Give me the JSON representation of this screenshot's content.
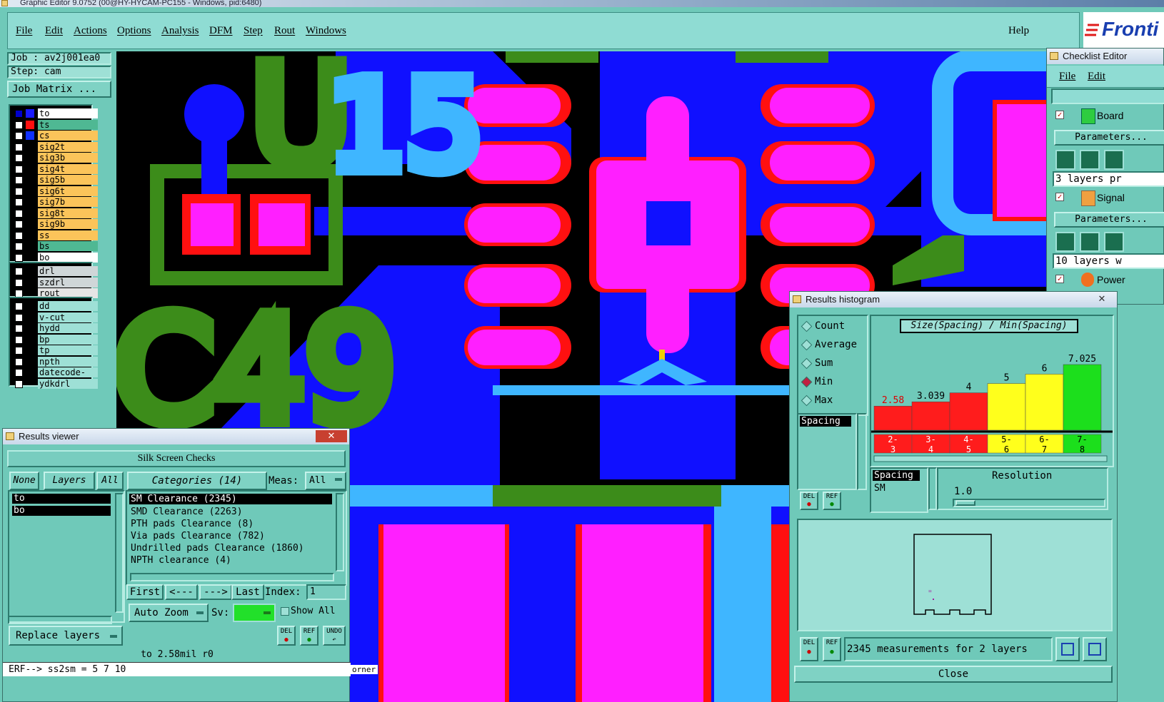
{
  "window_title": "Graphic Editor 9.0752 (00@HY-HYCAM-PC155 - Windows, pid:6480)",
  "menu": [
    "File",
    "Edit",
    "Actions",
    "Options",
    "Analysis",
    "DFM",
    "Step",
    "Rout",
    "Windows"
  ],
  "help_label": "Help",
  "logo_text": "Fronti",
  "job": {
    "job_label": "Job : av2j001ea0",
    "step_label": "Step: cam",
    "matrix_button": "Job Matrix ..."
  },
  "layers_group1": [
    {
      "name": "to",
      "color": "#1a1aff",
      "selected": true
    },
    {
      "name": "ts",
      "color": "#ff1010"
    },
    {
      "name": "cs",
      "color": "#1030ff"
    },
    {
      "name": "sig2t"
    },
    {
      "name": "sig3b"
    },
    {
      "name": "sig4t"
    },
    {
      "name": "sig5b"
    },
    {
      "name": "sig6t"
    },
    {
      "name": "sig7b"
    },
    {
      "name": "sig8t"
    },
    {
      "name": "sig9b"
    },
    {
      "name": "ss"
    },
    {
      "name": "bs"
    },
    {
      "name": "bo"
    }
  ],
  "layers_group2": [
    "drl",
    "szdrl",
    "rout"
  ],
  "layers_group3": [
    "dd",
    "v-cut",
    "hydd",
    "bp",
    "tp",
    "npth",
    "datecode-pte",
    "ydkdrl"
  ],
  "silkscreen": {
    "big_text1": "U",
    "big_text2": "15",
    "big_text3": "C49"
  },
  "results_viewer": {
    "title": "Results viewer",
    "header": "Silk Screen Checks",
    "tabs": {
      "none": "None",
      "layers": "Layers",
      "all": "All"
    },
    "layers": [
      "to",
      "bo"
    ],
    "categories_button": "Categories (14)",
    "meas_label": "Meas:",
    "meas_value": "All",
    "categories": [
      "SM Clearance (2345)",
      "SMD Clearance (2263)",
      "PTH pads Clearance (8)",
      "Via pads Clearance (782)",
      "Undrilled pads Clearance (1860)",
      "NPTH clearance (4)"
    ],
    "nav": {
      "first": "First",
      "prev": "<---",
      "next": "--->",
      "last": "Last",
      "index_label": "Index:",
      "index_value": "1"
    },
    "zoom": "Auto Zoom",
    "sv_label": "Sv:",
    "show_all": "Show All",
    "replace_layers": "Replace layers",
    "del": "DEL",
    "ref": "REF",
    "undo": "UNDO",
    "status": "to 2.58mil  r0",
    "erf": "ERF--> ss2sm = 5 7 10",
    "footer_partial": "orner"
  },
  "checklist": {
    "title": "Checklist Editor",
    "menu": [
      "File",
      "Edit"
    ],
    "items": [
      {
        "name": "Board",
        "params": "Parameters...",
        "summary": "3 layers pr"
      },
      {
        "name": "Signal",
        "params": "Parameters...",
        "summary": "10 layers w"
      },
      {
        "name": "Power"
      }
    ]
  },
  "histogram": {
    "title": "Results histogram",
    "modes": [
      "Count",
      "Average",
      "Sum",
      "Min",
      "Max"
    ],
    "selected_mode": "Min",
    "chart_title": "Size(Spacing) / Min(Spacing)",
    "list_label": "Spacing",
    "list2": [
      "Spacing",
      "SM"
    ],
    "resolution_label": "Resolution",
    "resolution_value": "1.0",
    "measurements": "2345 measurements for 2 layers",
    "close": "Close",
    "del": "DEL",
    "ref": "REF"
  },
  "chart_data": {
    "type": "bar",
    "title": "Size(Spacing) / Min(Spacing)",
    "categories": [
      "2-3",
      "3-4",
      "4-5",
      "5-6",
      "6-7",
      "7-8"
    ],
    "values": [
      2.58,
      3.039,
      4,
      5,
      6,
      7.025
    ],
    "colors": [
      "#ff1c1c",
      "#ff1c1c",
      "#ff1c1c",
      "#ffff1c",
      "#ffff1c",
      "#1cdf1c"
    ],
    "ylim": [
      0,
      7.025
    ]
  }
}
